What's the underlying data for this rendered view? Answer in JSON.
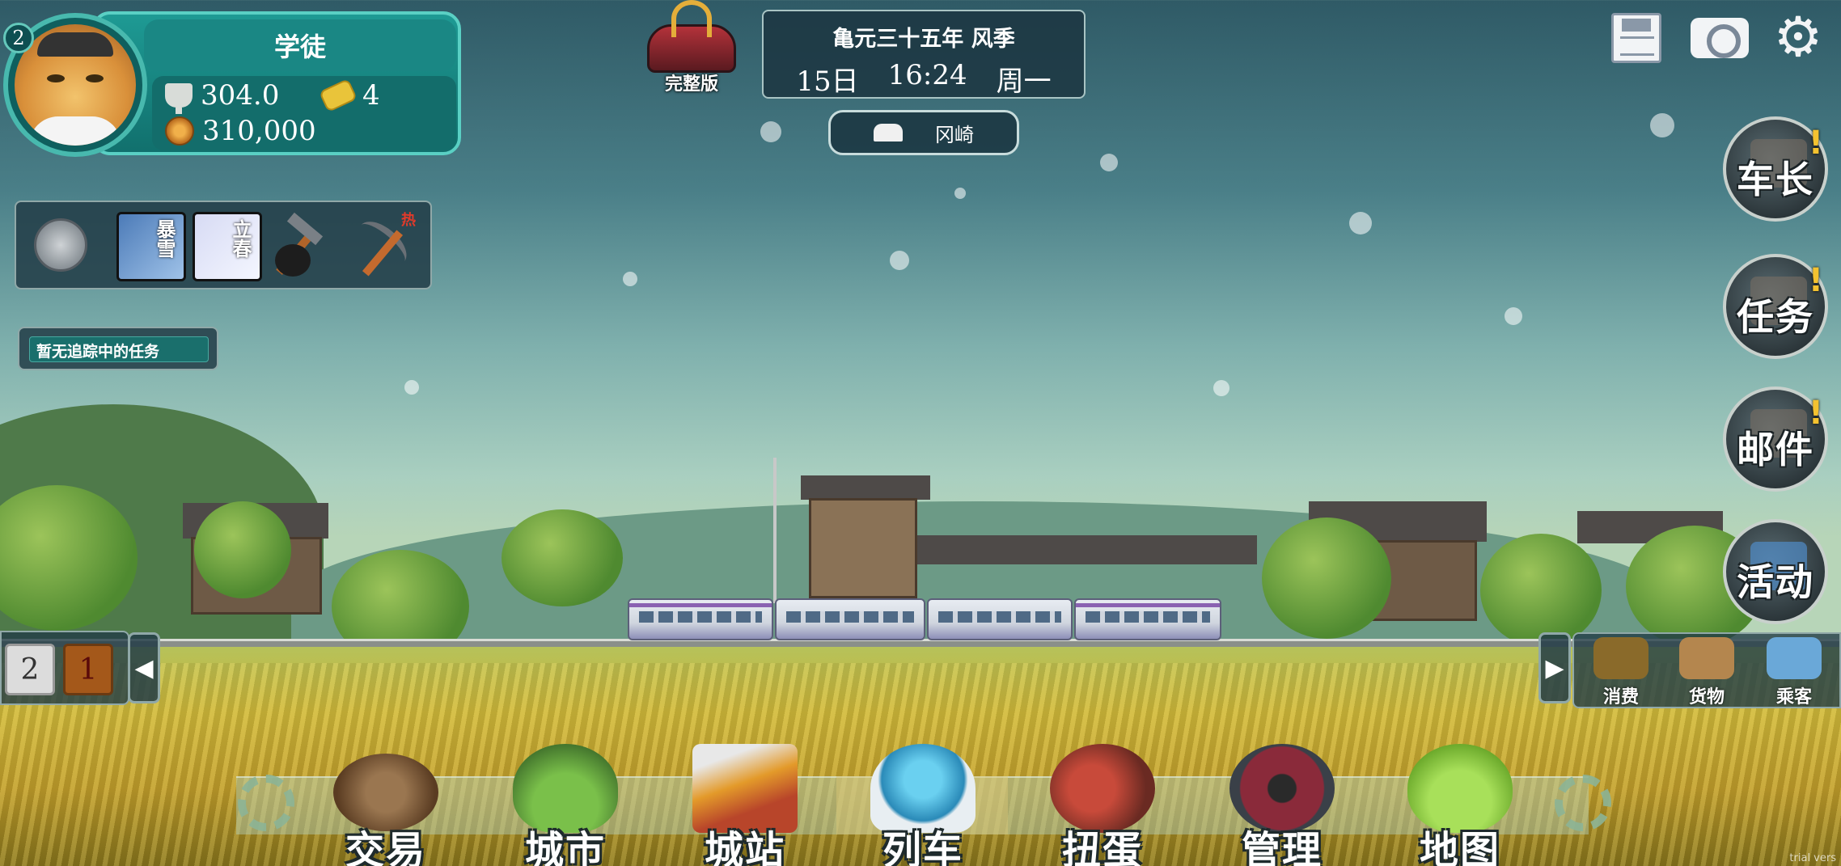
{
  "player": {
    "level": "2",
    "rank": "学徒",
    "trophy_score": "304.0",
    "tickets": "4",
    "coins": "310,000"
  },
  "edition": {
    "label": "完整版"
  },
  "calendar": {
    "era": "亀元三十五年 风季",
    "day": "15日",
    "time": "16:24",
    "weekday": "周一"
  },
  "location": {
    "city": "冈崎"
  },
  "top_right": [
    "save-icon",
    "camera-icon",
    "gear-icon"
  ],
  "weather_tools": {
    "cards": [
      "暴雪",
      "立春"
    ],
    "hot_tag": "热"
  },
  "task_tracker": {
    "text": "暂无追踪中的任务"
  },
  "side_menu": [
    {
      "label": "车长",
      "alert": "!"
    },
    {
      "label": "任务",
      "alert": "!"
    },
    {
      "label": "邮件",
      "alert": "!"
    },
    {
      "label": "活动",
      "alert": ""
    }
  ],
  "consist_left": {
    "car_a": "2",
    "car_b": "1",
    "arrow": "◀"
  },
  "consist_right": {
    "arrow": "▶",
    "items": [
      "消费",
      "货物",
      "乘客"
    ]
  },
  "bottom_nav": [
    "交易",
    "城市",
    "城站",
    "列车",
    "扭蛋",
    "管理",
    "地图"
  ],
  "watermark": "trial vers",
  "colors": {
    "panel_teal": "#1e9a94",
    "panel_border": "#5ad0c4",
    "alert_yellow": "#f4c230"
  }
}
